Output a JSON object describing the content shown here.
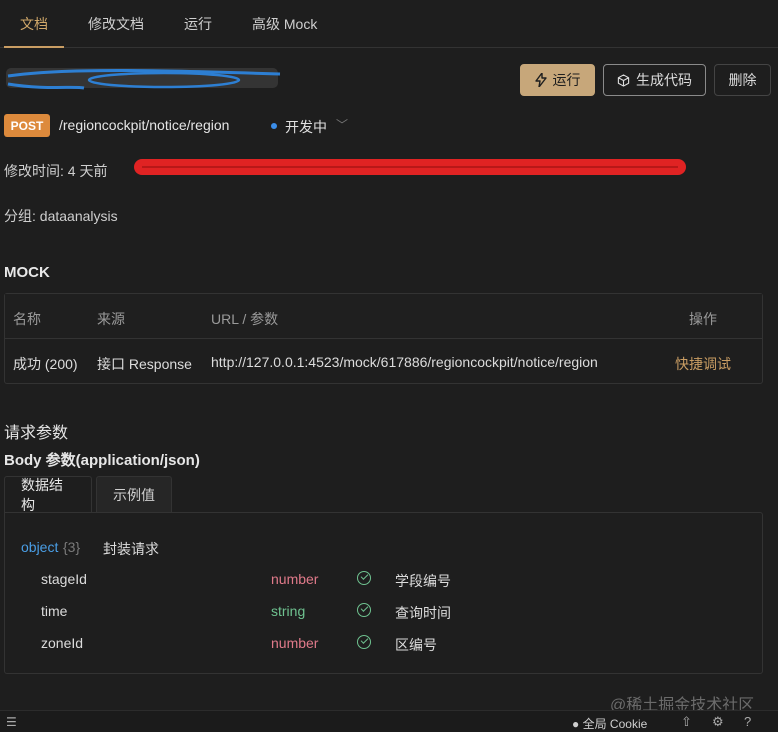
{
  "tabs": [
    {
      "label": "文档"
    },
    {
      "label": "修改文档"
    },
    {
      "label": "运行"
    },
    {
      "label": "高级 Mock"
    }
  ],
  "actions": {
    "run": "运行",
    "generate_code": "生成代码",
    "delete": "删除"
  },
  "api": {
    "method": "POST",
    "path": "/regioncockpit/notice/region",
    "status": "开发中",
    "modified": "修改时间: 4 天前",
    "group": "分组: dataanalysis"
  },
  "mock": {
    "title": "MOCK",
    "headers": [
      "名称",
      "来源",
      "URL / 参数",
      "操作"
    ],
    "rows": [
      {
        "name": "成功 (200)",
        "source": "接口 Response",
        "url": "http://127.0.0.1:4523/mock/617886/regioncockpit/notice/region",
        "action": "快捷调试"
      }
    ]
  },
  "request": {
    "title": "请求参数",
    "body_title": "Body 参数(application/json)",
    "tabs": [
      "数据结构",
      "示例值"
    ],
    "object_type": "object",
    "object_count": "{3}",
    "object_desc": "封装请求",
    "fields": [
      {
        "name": "stageId",
        "type": "number",
        "desc": "学段编号"
      },
      {
        "name": "time",
        "type": "string",
        "desc": "查询时间"
      },
      {
        "name": "zoneId",
        "type": "number",
        "desc": "区编号"
      }
    ]
  },
  "watermark": "@稀土掘金技术社区",
  "footer": {
    "cookie": "全局 Cookie"
  },
  "colors": {
    "accent": "#c99d63",
    "method_post": "#dd8a3c",
    "type_number": "#e07a8a",
    "type_string": "#6fc290",
    "status_dot": "#3b8eea"
  }
}
